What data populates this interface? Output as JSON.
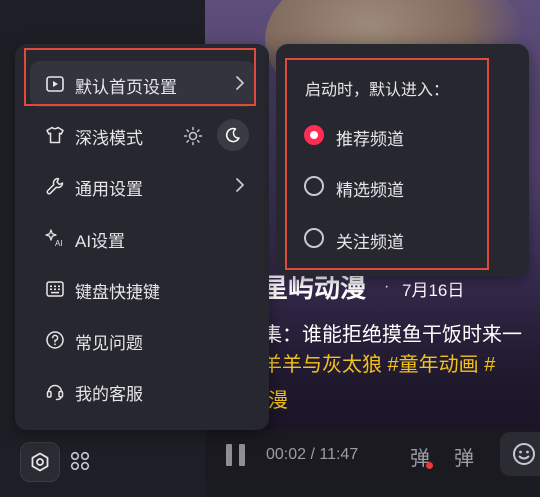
{
  "menu": {
    "items": [
      {
        "label": "默认首页设置",
        "icon": "play-square-icon",
        "has_submenu": true
      },
      {
        "label": "深浅模式",
        "icon": "tshirt-icon"
      },
      {
        "label": "通用设置",
        "icon": "wrench-icon",
        "has_submenu": true
      },
      {
        "label": "AI设置",
        "icon": "ai-sparkle-icon"
      },
      {
        "label": "键盘快捷键",
        "icon": "keyboard-icon"
      },
      {
        "label": "常见问题",
        "icon": "question-circle-icon"
      },
      {
        "label": "我的客服",
        "icon": "headset-icon"
      }
    ],
    "theme_options": [
      "sun-icon",
      "moon-icon"
    ],
    "theme_selected": "moon-icon"
  },
  "submenu": {
    "title": "启动时，默认进入：",
    "options": [
      {
        "label": "推荐频道",
        "selected": true
      },
      {
        "label": "精选频道",
        "selected": false
      },
      {
        "label": "关注频道",
        "selected": false
      }
    ]
  },
  "video": {
    "title": "星屿动漫",
    "date": "7月16日",
    "dot": "·",
    "subtitle": "集：谁能拒绝摸鱼干饭时来一",
    "tags_line1": "羊羊与灰太狼 #童年动画 #",
    "tags_line2": "漫"
  },
  "player": {
    "time": "00:02 / 11:47",
    "danmaku_label": "弹",
    "danmaku_label2": "弹"
  },
  "colors": {
    "accent": "#ff2d55",
    "highlight_box": "#e04a3a",
    "tag_yellow": "#f2c21a",
    "menu_bg": "#26272f"
  }
}
